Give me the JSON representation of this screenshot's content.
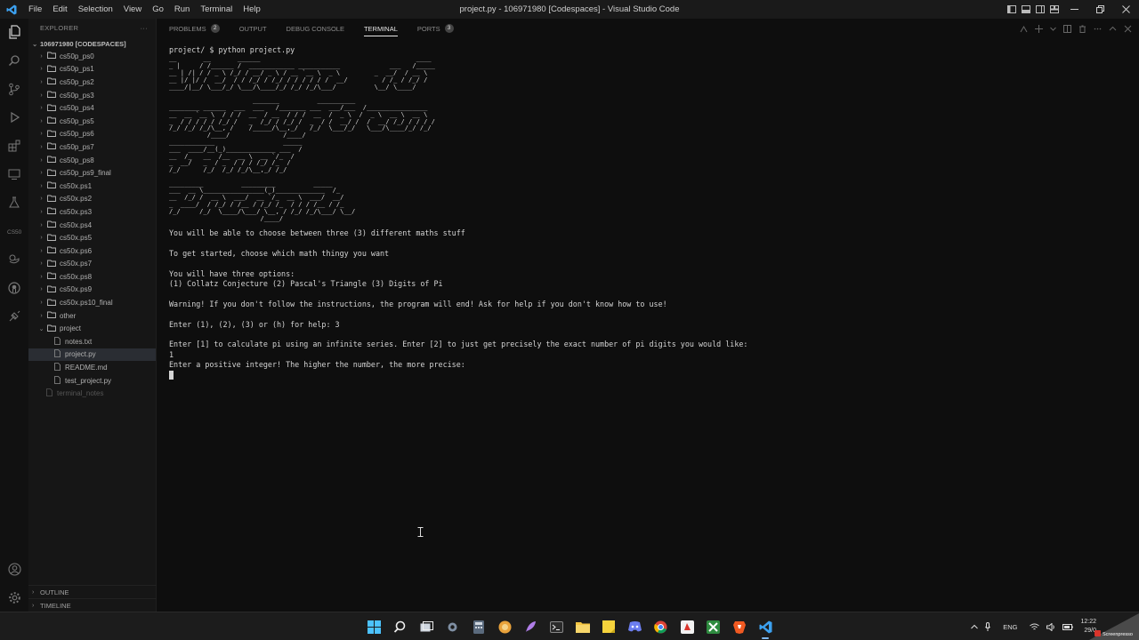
{
  "titlebar": {
    "menu": [
      "File",
      "Edit",
      "Selection",
      "View",
      "Go",
      "Run",
      "Terminal",
      "Help"
    ],
    "title": "project.py - 106971980 [Codespaces] - Visual Studio Code"
  },
  "sidebar": {
    "header": "EXPLORER",
    "root": "106971980 [CODESPACES]",
    "folders": [
      "cs50p_ps0",
      "cs50p_ps1",
      "cs50p_ps2",
      "cs50p_ps3",
      "cs50p_ps4",
      "cs50p_ps5",
      "cs50p_ps6",
      "cs50p_ps7",
      "cs50p_ps8",
      "cs50p_ps9_final",
      "cs50x.ps1",
      "cs50x.ps2",
      "cs50x.ps3",
      "cs50x.ps4",
      "cs50x.ps5",
      "cs50x.ps6",
      "cs50x.ps7",
      "cs50x.ps8",
      "cs50x.ps9",
      "cs50x.ps10_final",
      "other"
    ],
    "open_folder": "project",
    "files": [
      "notes.txt",
      "project.py",
      "README.md",
      "test_project.py"
    ],
    "selected_file": "project.py",
    "dim_file": "terminal_notes",
    "outline": "OUTLINE",
    "timeline": "TIMELINE"
  },
  "panel": {
    "tabs": [
      {
        "label": "PROBLEMS",
        "badge": "2"
      },
      {
        "label": "OUTPUT",
        "badge": ""
      },
      {
        "label": "DEBUG CONSOLE",
        "badge": ""
      },
      {
        "label": "TERMINAL",
        "badge": ""
      },
      {
        "label": "PORTS",
        "badge": "3"
      }
    ],
    "active_tab": "TERMINAL"
  },
  "terminal": {
    "prompt": "project/ $ python project.py",
    "banner": [
      "__       __       ______                                         ____",
      "_ |     / /______ /  ____________ ___________             ___   /_____",
      "__ | /| / / _ \\ /_/ / __/ _ \\ / __ `__ \\  _ \\         _  __/  / __ \\",
      "__ |/ |/ /  __/  / / /_/ / /_/ / / / / / /  __/         / /_ / /_/ /",
      "____/|__/ \\___/_/ \\___/\\____/_/ /_/ /_/\\___/          \\__/ \\____/",
      "",
      "                      _______          __________",
      "________ ______  ___  ___   /_______ ___  ___/___  /________________",
      "__  __ `__ \\  / / /  __  / __  / / /  __  /  _ \\  /  _ \\  __ \\  __ \\",
      "_  / / / / / /_/ /   _  /_/ / /_/ /  _  / /  __/ /  /  __/ /_/ / / / /",
      "/_/ /_/ /_/\\__, /    /_____/\\__,_/   /_/  \\___/_/   \\___/\\____/_/ /_/",
      "          /____/              /____/",
      "____________                  _____",
      "___  ____/__(_)_____________ ___  /",
      "__  /_   __  /__  __ \\  __ `/_  /",
      "_  __/   _  / _  / / / /_/ /_  /",
      "/_/      /_/  /_/ /_/\\__,_/ /_/",
      "",
      "_________          _________          _____",
      "___  __ \\________________(_)_____________  /_",
      "__  /_/ /  __ \\  ___/  __ `/_  __ \\  ___/  __/",
      "_  ____/  / /_/ / /__ / /_/ /_  / / / /__ / /_",
      "/_/     /_/  \\____/\\___/ \\__, / /_/ /_/\\___/ \\__/",
      "                        /____/"
    ],
    "lines": [
      "You will be able to choose between three (3) different maths stuff",
      "",
      "To get started, choose which math thingy you want",
      "",
      "You will have three options:",
      "(1) Collatz Conjecture (2) Pascal's Triangle (3) Digits of Pi",
      "",
      "Warning! If you don't follow the instructions, the program will end! Ask for help if you don't know how to use!",
      "",
      "Enter (1), (2), (3) or (h) for help: 3",
      "",
      "Enter [1] to calculate pi using an infinite series. Enter [2] to just get precisely the exact number of pi digits you would like:",
      "1",
      "Enter a positive integer! The higher the number, the more precise:"
    ]
  },
  "taskbar": {
    "apps": [
      "windows-start",
      "search",
      "task-view",
      "settings",
      "calculator",
      "browser-edge",
      "feather-app",
      "terminal",
      "file-explorer",
      "sticky-notes",
      "discord",
      "chrome",
      "app-red",
      "app-green",
      "brave",
      "vscode"
    ],
    "tray": {
      "language": "ENG",
      "time": "12:22",
      "date": "29/0"
    },
    "brand": "Screenpresso"
  },
  "colors": {
    "accent": "#007acc",
    "background": "#0e0e0e",
    "sidebar": "#161616",
    "folder": "#c9a74a"
  }
}
